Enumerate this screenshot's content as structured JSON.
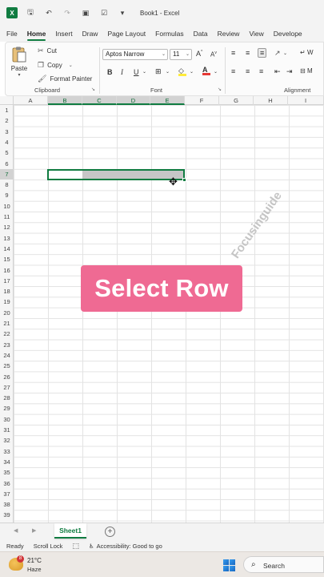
{
  "titlebar": {
    "app_logo": "X",
    "title": "Book1 - Excel",
    "icons": [
      "save-icon",
      "undo-icon",
      "redo-icon",
      "camera-icon",
      "checklist-icon",
      "more-icon"
    ]
  },
  "tabs": [
    "File",
    "Home",
    "Insert",
    "Draw",
    "Page Layout",
    "Formulas",
    "Data",
    "Review",
    "View",
    "Develope"
  ],
  "active_tab": "Home",
  "ribbon": {
    "clipboard": {
      "paste": "Paste",
      "cut": "Cut",
      "copy": "Copy",
      "format_painter": "Format Painter",
      "label": "Clipboard"
    },
    "font": {
      "font_name": "Aptos Narrow",
      "font_size": "11",
      "grow": "A",
      "shrink": "A",
      "bold": "B",
      "italic": "I",
      "underline": "U",
      "font_color_letter": "A",
      "label": "Font"
    },
    "alignment": {
      "wrap_prefix": "W",
      "merge_prefix": "M",
      "label": "Alignment"
    }
  },
  "columns": [
    "A",
    "B",
    "C",
    "D",
    "E",
    "F",
    "G",
    "H",
    "I"
  ],
  "rows": [
    "1",
    "2",
    "3",
    "4",
    "5",
    "6",
    "7",
    "8",
    "9",
    "10",
    "11",
    "12",
    "13",
    "14",
    "15",
    "16",
    "17",
    "18",
    "19",
    "20",
    "21",
    "22",
    "23",
    "24",
    "25",
    "26",
    "27",
    "28",
    "29",
    "30",
    "31",
    "32",
    "33",
    "34",
    "35",
    "36",
    "37",
    "38",
    "39"
  ],
  "selected_row": "7",
  "selected_columns": [
    "B",
    "C",
    "D",
    "E"
  ],
  "overlay": {
    "watermark": "Focusinguide",
    "banner": "Select Row",
    "banner_color": "#ef6a93"
  },
  "sheets": {
    "tabs": [
      "Sheet1"
    ],
    "active": "Sheet1",
    "add": "+"
  },
  "status": {
    "ready": "Ready",
    "scroll_lock": "Scroll Lock",
    "accessibility": "Accessibility: Good to go"
  },
  "taskbar": {
    "weather_badge": "8",
    "temperature": "21°C",
    "condition": "Haze",
    "search": "Search"
  },
  "colors": {
    "excel_green": "#107c41",
    "selection_fill": "#c6c6c6"
  }
}
